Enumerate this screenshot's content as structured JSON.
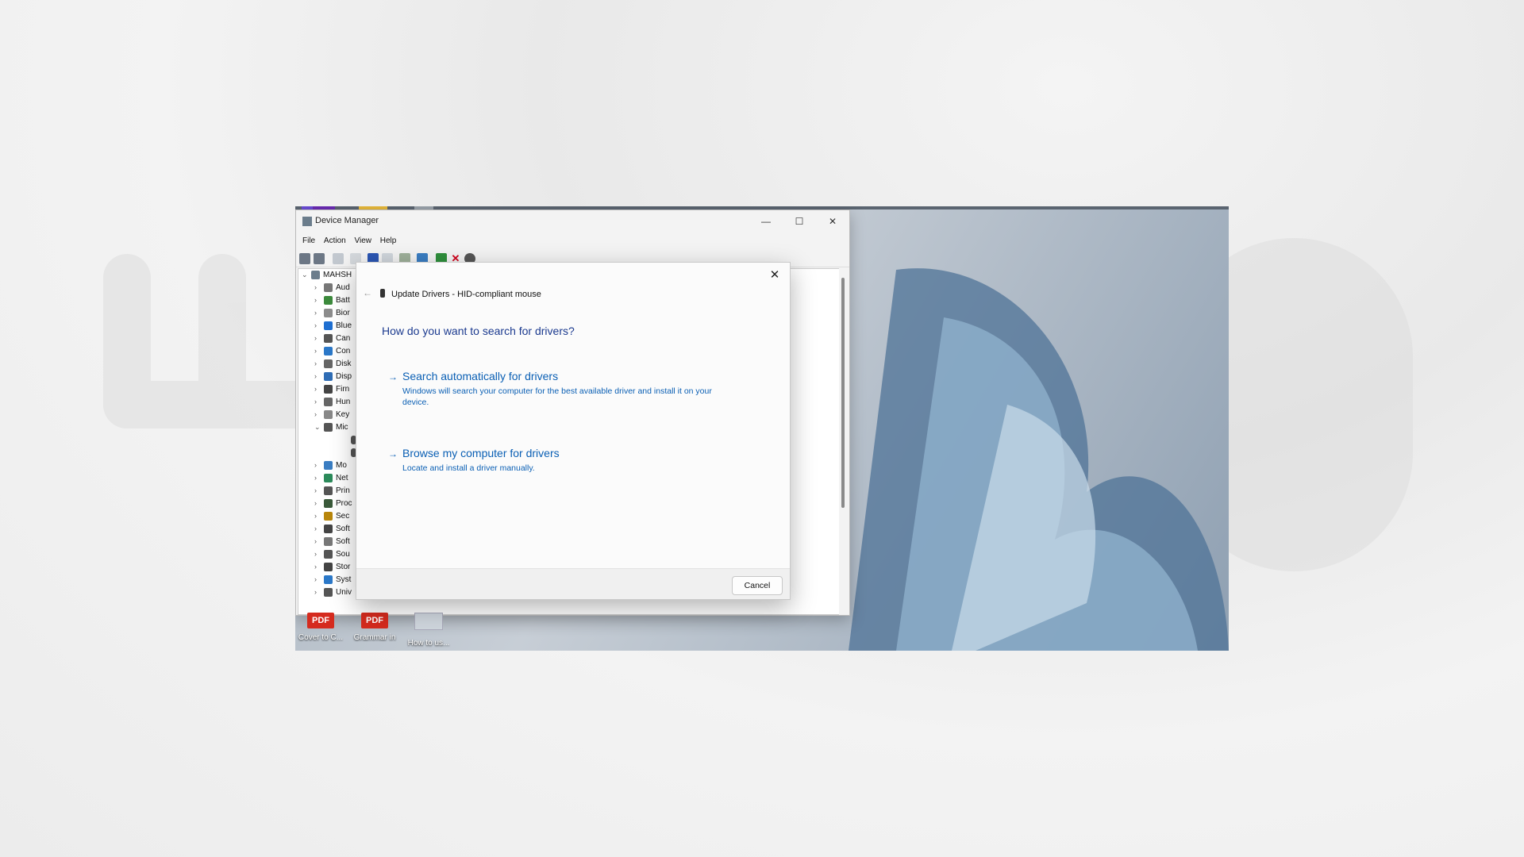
{
  "device_manager": {
    "title": "Device Manager",
    "menu": [
      "File",
      "Action",
      "View",
      "Help"
    ],
    "root_label": "MAHSH",
    "tree_items": [
      "Aud",
      "Batt",
      "Bior",
      "Blue",
      "Can",
      "Con",
      "Disk",
      "Disp",
      "Firn",
      "Hun",
      "Key",
      "Mic",
      "",
      "",
      "Mo",
      "Net",
      "Prin",
      "Proc",
      "Sec",
      "Soft",
      "Soft",
      "Sou",
      "Stor",
      "Syst",
      "Univ"
    ]
  },
  "dialog": {
    "header": "Update Drivers - HID-compliant mouse",
    "question": "How do you want to search for drivers?",
    "option1_title": "Search automatically for drivers",
    "option1_desc": "Windows will search your computer for the best available driver and install it on your device.",
    "option2_title": "Browse my computer for drivers",
    "option2_desc": "Locate and install a driver manually.",
    "cancel_label": "Cancel",
    "close_glyph": "✕",
    "back_glyph": "←"
  },
  "desktop": {
    "icons": [
      {
        "badge": "PDF",
        "label": "Cover to C..."
      },
      {
        "badge": "PDF",
        "label": "Grammar in"
      },
      {
        "badge": "",
        "label": "How to us..."
      }
    ]
  },
  "colors": {
    "accent_blue": "#0a5fb4",
    "heading_blue": "#1b3a8f",
    "pdf_red": "#d52b1e"
  },
  "window_controls": {
    "minimize": "—",
    "maximize": "☐",
    "close": "✕"
  }
}
